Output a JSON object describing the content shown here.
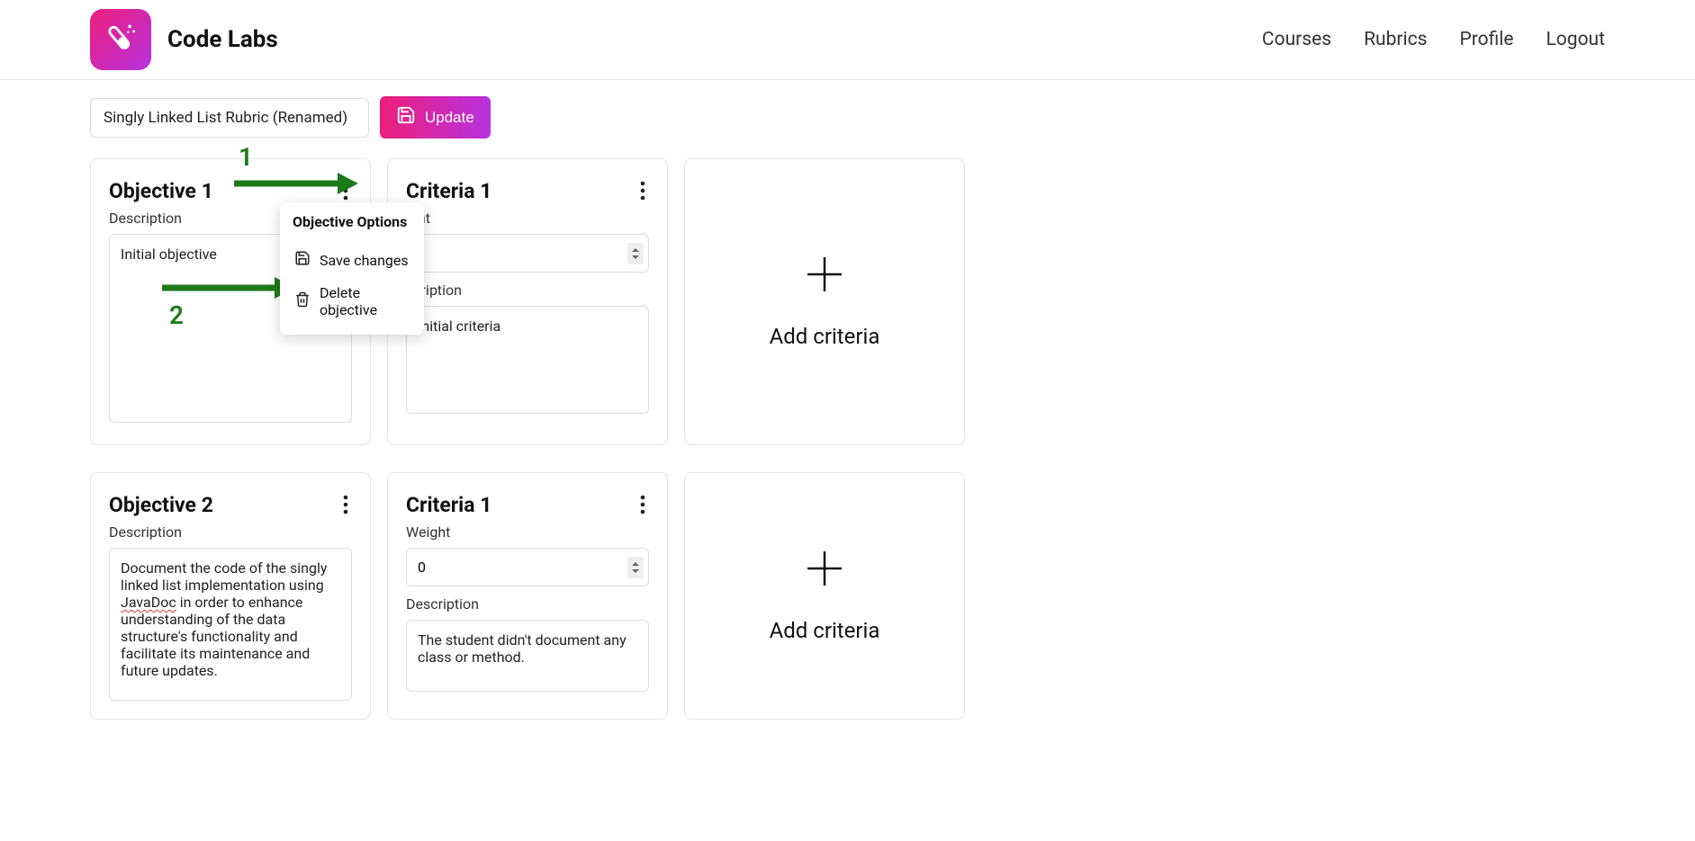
{
  "brand": {
    "name": "Code Labs"
  },
  "nav": {
    "courses": "Courses",
    "rubrics": "Rubrics",
    "profile": "Profile",
    "logout": "Logout"
  },
  "toolbar": {
    "rubric_name": "Singly Linked List Rubric (Renamed)",
    "update_label": "Update"
  },
  "popup": {
    "header": "Objective Options",
    "save": "Save changes",
    "delete": "Delete objective"
  },
  "rows": {
    "r1": {
      "obj": {
        "title": "Objective 1",
        "desc_label": "Description",
        "desc_value": "Initial objective"
      },
      "crit": {
        "title": "Criteria 1",
        "weight_label": "ight",
        "weight_value": "",
        "desc_label": "scription",
        "desc_value": "Initial criteria"
      },
      "add": {
        "label": "Add criteria"
      }
    },
    "r2": {
      "obj": {
        "title": "Objective 2",
        "desc_label": "Description",
        "desc_prefix": "Document the code of the singly linked list implementation using ",
        "desc_underlined": "JavaDoc",
        "desc_suffix": " in order to enhance understanding of the data structure's functionality and facilitate its maintenance and future updates."
      },
      "crit": {
        "title": "Criteria 1",
        "weight_label": "Weight",
        "weight_value": "0",
        "desc_label": "Description",
        "desc_value": "The student didn't document any class or method."
      },
      "add": {
        "label": "Add criteria"
      }
    }
  },
  "annotations": {
    "a1": "1",
    "a2": "2"
  }
}
